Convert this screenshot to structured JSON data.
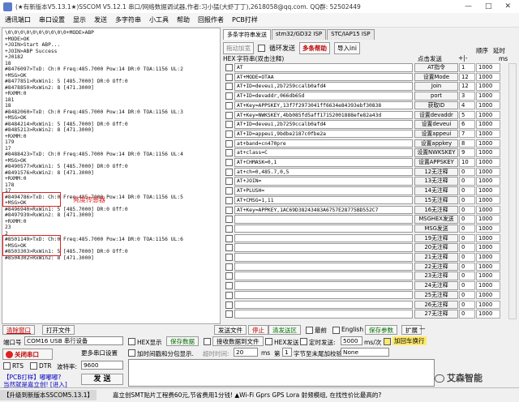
{
  "titlebar": {
    "text": "(★有新版本V5.13.1★)SSCOM V5.12.1 串口/网络数据调试器,作者:习小猛(大虾丁丁),2618058@qq.com. QQ群: 52502449",
    "min": "—",
    "max": "□",
    "close": "✕"
  },
  "menubar": [
    "通讯端口",
    "串口设置",
    "显示",
    "发送",
    "多字符串",
    "小工具",
    "帮助",
    "回报作者",
    "PCB打样"
  ],
  "terminal": [
    "\\0\\0\\0\\0\\0\\0\\0\\0\\0\\0+MODE>ABP",
    "+MODE>OK",
    "+JOIN>Start ABP...",
    "+JOIN>ABP Success",
    "+J0182",
    "18",
    "#8476097>TxD: Ch:0 Freq:485.7000 Pow:14 DR:0 TOA:1156 UL:2",
    "+MSG>OK",
    "#8477851>RxWin1: 5 [485.7000] DR:0 Off:0",
    "#8478850>RxWin2: 8 [471.3000]",
    "+RXMM:0",
    "181",
    "18",
    "#8482060>TxD: Ch:0 Freq:485.7000 Pow:14 DR:0 TOA:1156 UL:3",
    "+MSG>OK",
    "#8484214>RxWin1: 5 [485.7000] DR:0 Off:0",
    "#8485213>RxWin2: 8 [471.3000]",
    "+RXMM:0",
    "179",
    "17",
    "#8488423>TxD: Ch:0 Freq:485.7000 Pow:14 DR:0 TOA:1156 UL:4",
    "+MSG>OK",
    "#8490577>RxWin1: 5 [485.7000] DR:0 Off:0",
    "#8491576>RxWin2: 8 [471.3000]",
    "+RXMM:0",
    "178",
    "17",
    "#8494786>TxD: Ch:0 Freq:485.7000 Pow:14 DR:0 TOA:1156 UL:5",
    "+MSG>OK",
    "#8496940>RxWin1: 5 [485.7000] DR:0 Off:0",
    "#8497939>RxWin2: 8 [471.3000]",
    "+RXMM:0",
    "23",
    "2",
    "#8501149>TxD: Ch:0 Freq:485.7000 Pow:14 DR:0 TOA:1156 UL:6",
    "+MSG>OK",
    "#8503303>RxWin1: 5 [485.7000] DR:0 Off:0",
    "#8504302>RxWin2: 8 [471.3000]"
  ],
  "annotation": "亮度传感器",
  "tabs": [
    "多条字符串发送",
    "stm32/GD32 ISP",
    "STC/IAP15 ISP"
  ],
  "topctl": {
    "a": "拖动加宽",
    "b": "循环发送",
    "c": "多条帮助",
    "d": "导入ini"
  },
  "colhdr": {
    "hex": "HEX",
    "str": "字符串(双击注释)",
    "click": "点击发送",
    "pm": "+|-",
    "order": "顺序",
    "delay": "延时",
    "ms": "ms"
  },
  "rows": [
    {
      "t": "AT",
      "b": "AT指令",
      "o": "1",
      "d": "1000"
    },
    {
      "t": "AT+MODE=OTAA",
      "b": "设置Mode",
      "o": "12",
      "d": "1000"
    },
    {
      "t": "AT+ID=deveui,2b7259ccalb0afd4",
      "b": "Join",
      "o": "12",
      "d": "1000"
    },
    {
      "t": "AT+ID=devaddr,066db65d",
      "b": "port",
      "o": "3",
      "d": "1000"
    },
    {
      "t": "AT+Key=APPSKEY,13f7f2973041ff6634e84393ebf30838",
      "b": "获取ID",
      "o": "4",
      "d": "1000"
    },
    {
      "t": "AT+Key=NWKSKEY,4bb085fd5aff17152001888efe82a43d",
      "b": "设置devaddr",
      "o": "5",
      "d": "1000"
    },
    {
      "t": "AT+ID=deveui,2b7259ccalb0afd4",
      "b": "设置deveui",
      "o": "6",
      "d": "1000"
    },
    {
      "t": "AT+ID=appeui,9bdbe2187c0fbe2a",
      "b": "设置appeui",
      "o": "7",
      "d": "1000"
    },
    {
      "t": "at+band=cn470pre",
      "b": "设置appkey",
      "o": "8",
      "d": "1000"
    },
    {
      "t": "at+class=C",
      "b": "设置NWKSKEY",
      "o": "9",
      "d": "1000"
    },
    {
      "t": "AT+CHMASK=0,1",
      "b": "设置APPSKEY",
      "o": "10",
      "d": "1000"
    },
    {
      "t": "at+ch=0,485.7,0,5",
      "b": "12无注释",
      "o": "0",
      "d": "1000"
    },
    {
      "t": "AT+JOIN=",
      "b": "13无注释",
      "o": "0",
      "d": "1000"
    },
    {
      "t": "AT+PLUSH=",
      "b": "14无注释",
      "o": "0",
      "d": "1000"
    },
    {
      "t": "AT+CMSG=1,11",
      "b": "15无注释",
      "o": "0",
      "d": "1000"
    },
    {
      "t": "AT+Key=APPKEY,1AC69D38243483A6757E28775BD552C7",
      "b": "16无注释",
      "o": "0",
      "d": "1000"
    },
    {
      "t": "",
      "b": "MSGHEX发送",
      "o": "0",
      "d": "1000"
    },
    {
      "t": "",
      "b": "MSG发送",
      "o": "0",
      "d": "1000"
    },
    {
      "t": "",
      "b": "19无注释",
      "o": "0",
      "d": "1000"
    },
    {
      "t": "",
      "b": "20无注释",
      "o": "0",
      "d": "1000"
    },
    {
      "t": "",
      "b": "21无注释",
      "o": "0",
      "d": "1000"
    },
    {
      "t": "",
      "b": "22无注释",
      "o": "0",
      "d": "1000"
    },
    {
      "t": "",
      "b": "23无注释",
      "o": "0",
      "d": "1000"
    },
    {
      "t": "",
      "b": "24无注释",
      "o": "0",
      "d": "1000"
    },
    {
      "t": "",
      "b": "25无注释",
      "o": "0",
      "d": "1000"
    },
    {
      "t": "",
      "b": "26无注释",
      "o": "0",
      "d": "1000"
    },
    {
      "t": "",
      "b": "27无注释",
      "o": "0",
      "d": "1000"
    }
  ],
  "bottom": {
    "clear": "清除窗口",
    "openfile": "打开文件",
    "sendfile": "发送文件",
    "stop": "停止",
    "clearsend": "清发送区",
    "latest": "最前",
    "english": "English",
    "saveparam": "保存参数",
    "expand": "扩展",
    "dash": "—",
    "port_label": "端口号",
    "port_value": "COM16 USB 串行设备",
    "hexshow": "HEX显示",
    "savedata": "保存数据",
    "recvfile": "接收数据到文件",
    "hexsend": "HEX发送",
    "timesend": "定时发送:",
    "interval": "5000",
    "unit": "ms/次",
    "crlf": "加回车换行",
    "closeport": "关闭串口",
    "moreport": "更多串口设置",
    "timestamp": "加时间戳和分包显示.",
    "timeout_label": "超时时间:",
    "timeout": "20",
    "ms": "ms",
    "byte_label": "第",
    "byte": "1",
    "byte_tail": "字节至末尾加校验:",
    "checksum": "None",
    "rts": "RTS",
    "dtr": "DTR",
    "baud_label": "波特率:",
    "baud": "9600",
    "promo1": "【PCB打样】嘟嘟嘟?",
    "promo2": "当然就是嘉立创! [进入]",
    "send": "发 送"
  },
  "statusbar": {
    "upgrade": "【升级到新版本SSCOM5.13.1】",
    "ad": "嘉立创SMT贴片工程费60元,节省费用1分钱! ▲Wi-Fi Gprs GPS Lora 射频模组, 在找性价比最高的?"
  },
  "watermark": "艾森智能"
}
